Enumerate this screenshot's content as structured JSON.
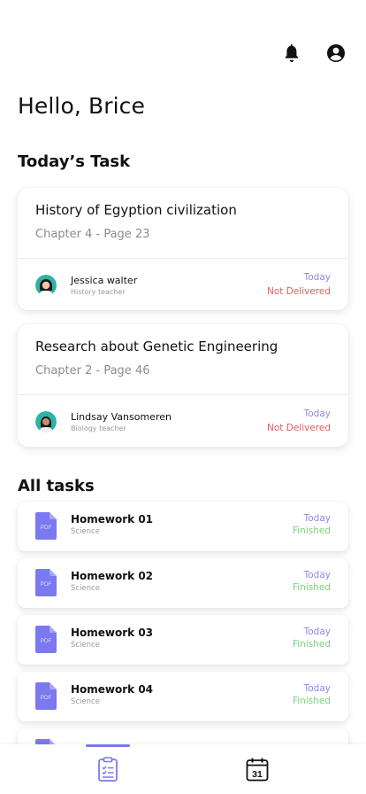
{
  "header": {
    "greeting": "Hello, Brice"
  },
  "sections": {
    "today": "Today’s Task",
    "all": "All tasks"
  },
  "today_tasks": [
    {
      "title": "History of Egyption civilization",
      "chapter": "Chapter 4 - Page 23",
      "teacher": "Jessica walter",
      "role": "History teacher",
      "when": "Today",
      "status": "Not Delivered"
    },
    {
      "title": "Research about Genetic Engineering",
      "chapter": "Chapter 2 - Page 46",
      "teacher": "Lindsay Vansomeren",
      "role": "Biology teacher",
      "when": "Today",
      "status": "Not Delivered"
    }
  ],
  "pdf_label": "PDF",
  "homeworks": [
    {
      "title": "Homework 01",
      "subject": "Science",
      "when": "Today",
      "status": "Finished"
    },
    {
      "title": "Homework 02",
      "subject": "Science",
      "when": "Today",
      "status": "Finished"
    },
    {
      "title": "Homework 03",
      "subject": "Science",
      "when": "Today",
      "status": "Finished"
    },
    {
      "title": "Homework 04",
      "subject": "Science",
      "when": "Today",
      "status": "Finished"
    }
  ],
  "nav": {
    "calendar_day": "31"
  },
  "icons": [
    "bell-icon",
    "account-icon",
    "pdf-icon",
    "clipboard-tasks-icon",
    "calendar-icon"
  ],
  "colors": {
    "accent": "#7a79ef",
    "today": "#8d88e6",
    "not_delivered": "#e25b5b",
    "finished": "#7bcf7b"
  }
}
